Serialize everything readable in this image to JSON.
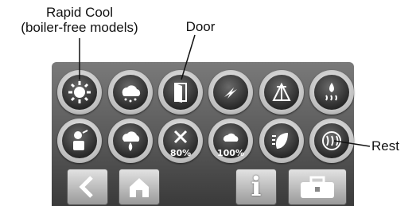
{
  "callouts": {
    "rapid_cool": "Rapid Cool\n(boiler-free models)",
    "door": "Door",
    "rest": "Rest"
  },
  "buttons_row1": [
    {
      "icon": "rapid-cool-icon"
    },
    {
      "icon": "steam-cloud-icon"
    },
    {
      "icon": "door-icon"
    },
    {
      "icon": "lightning-icon"
    },
    {
      "icon": "tower-icon"
    },
    {
      "icon": "humidity-flame-icon"
    }
  ],
  "buttons_row2": [
    {
      "icon": "person-pause-icon"
    },
    {
      "icon": "steam-fire-icon"
    },
    {
      "icon": "fan-80-icon",
      "label": "80%"
    },
    {
      "icon": "steam-100-icon",
      "label": "100%"
    },
    {
      "icon": "leaf-vent-icon"
    },
    {
      "icon": "rest-icon"
    }
  ],
  "nav": {
    "back_icon": "chevron-left-icon",
    "home_icon": "home-icon",
    "info_label": "i",
    "toolbox_icon": "toolbox-icon"
  },
  "colors": {
    "accent": "#ffffff",
    "screen": "#555555"
  }
}
